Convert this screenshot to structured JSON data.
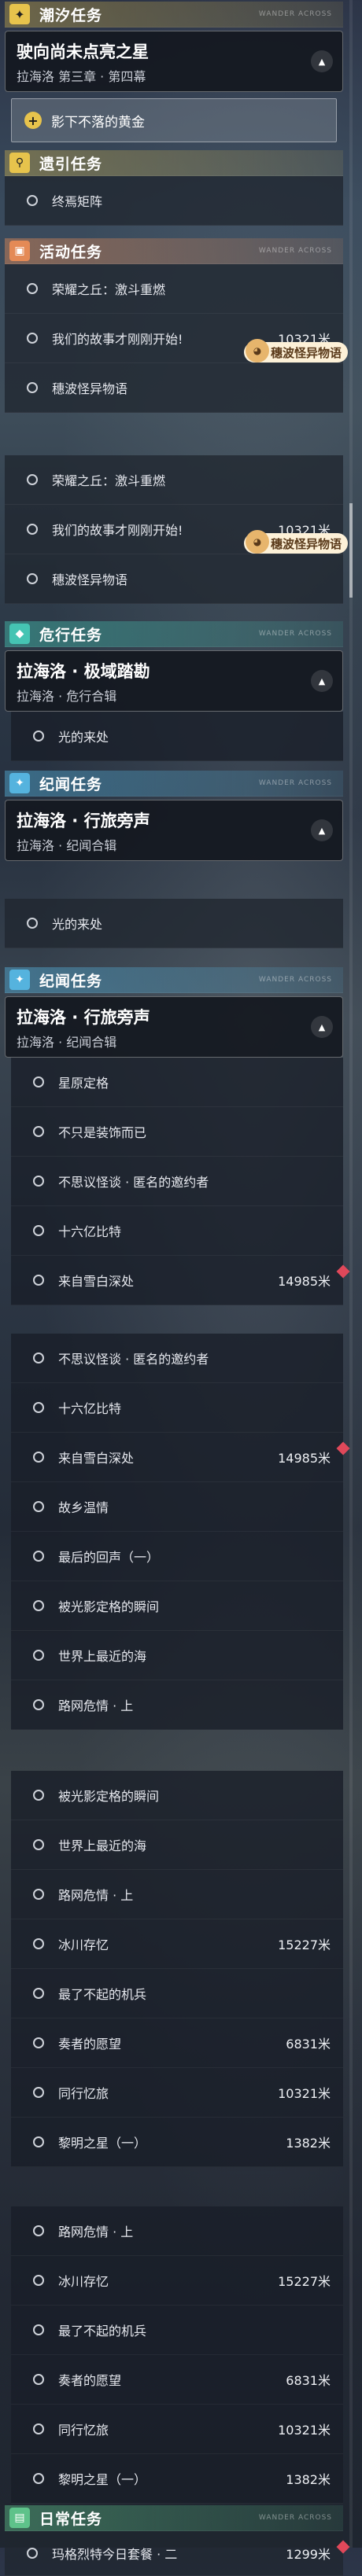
{
  "colors": {
    "tide": "#e7c34c",
    "guide": "#e7c34c",
    "activity": "#e48a56",
    "danger": "#45c4b3",
    "chronicle": "#55b3de",
    "daily": "#5ec28a",
    "marker": "#e0485a"
  },
  "s1": {
    "title": "潮汐任务",
    "deco": "WANDER ACROSS",
    "feature": {
      "title": "驶向尚未点亮之星",
      "subtitle": "拉海洛 第三章 · 第四幕"
    },
    "objective": "影下不落的黄金"
  },
  "s2": {
    "title": "遗引任务",
    "items": [
      "终焉矩阵"
    ]
  },
  "s3": {
    "title": "活动任务",
    "deco": "WANDER ACROSS",
    "items": [
      {
        "label": "荣耀之丘：激斗重燃"
      },
      {
        "label": "我们的故事才刚刚开始!",
        "dist": "10321米"
      },
      {
        "label": "穗波怪异物语"
      }
    ],
    "sticker": "穗波怪异物语"
  },
  "s4": {
    "items": [
      {
        "label": "荣耀之丘：激斗重燃"
      },
      {
        "label": "我们的故事才刚刚开始!",
        "dist": "10321米"
      },
      {
        "label": "穗波怪异物语"
      }
    ],
    "sticker": "穗波怪异物语"
  },
  "s5": {
    "title": "危行任务",
    "deco": "WANDER ACROSS",
    "feature": {
      "title": "拉海洛 · 极域踏勘",
      "subtitle": "拉海洛 · 危行合辑"
    },
    "items": [
      "光的来处"
    ]
  },
  "s6": {
    "title": "纪闻任务",
    "deco": "WANDER ACROSS",
    "feature": {
      "title": "拉海洛 · 行旅旁声",
      "subtitle": "拉海洛 · 纪闻合辑"
    }
  },
  "s7": {
    "items": [
      "光的来处"
    ]
  },
  "s8": {
    "title": "纪闻任务",
    "deco": "WANDER ACROSS",
    "feature": {
      "title": "拉海洛 · 行旅旁声",
      "subtitle": "拉海洛 · 纪闻合辑"
    },
    "items": [
      {
        "label": "星原定格"
      },
      {
        "label": "不只是装饰而已"
      },
      {
        "label": "不思议怪谈 · 匿名的邀约者"
      },
      {
        "label": "十六亿比特"
      },
      {
        "label": "来自雪白深处",
        "dist": "14985米"
      }
    ]
  },
  "s9": {
    "items": [
      {
        "label": "不思议怪谈 · 匿名的邀约者"
      },
      {
        "label": "十六亿比特"
      },
      {
        "label": "来自雪白深处",
        "dist": "14985米"
      },
      {
        "label": "故乡温情"
      },
      {
        "label": "最后的回声（一）"
      },
      {
        "label": "被光影定格的瞬间"
      },
      {
        "label": "世界上最近的海"
      },
      {
        "label": "路网危情 · 上"
      }
    ]
  },
  "s10": {
    "items": [
      {
        "label": "被光影定格的瞬间"
      },
      {
        "label": "世界上最近的海"
      },
      {
        "label": "路网危情 · 上"
      },
      {
        "label": "冰川存忆",
        "dist": "15227米"
      },
      {
        "label": "最了不起的机兵"
      },
      {
        "label": "奏者的愿望",
        "dist": "6831米"
      },
      {
        "label": "同行忆旅",
        "dist": "10321米"
      },
      {
        "label": "黎明之星（一）",
        "dist": "1382米"
      }
    ]
  },
  "s11": {
    "items": [
      {
        "label": "路网危情 · 上"
      },
      {
        "label": "冰川存忆",
        "dist": "15227米"
      },
      {
        "label": "最了不起的机兵"
      },
      {
        "label": "奏者的愿望",
        "dist": "6831米"
      },
      {
        "label": "同行忆旅",
        "dist": "10321米"
      },
      {
        "label": "黎明之星（一）",
        "dist": "1382米"
      }
    ]
  },
  "s12": {
    "title": "日常任务",
    "deco": "WANDER ACROSS",
    "items": [
      {
        "label": "玛格烈特今日套餐 · 二",
        "dist": "1299米"
      }
    ]
  }
}
